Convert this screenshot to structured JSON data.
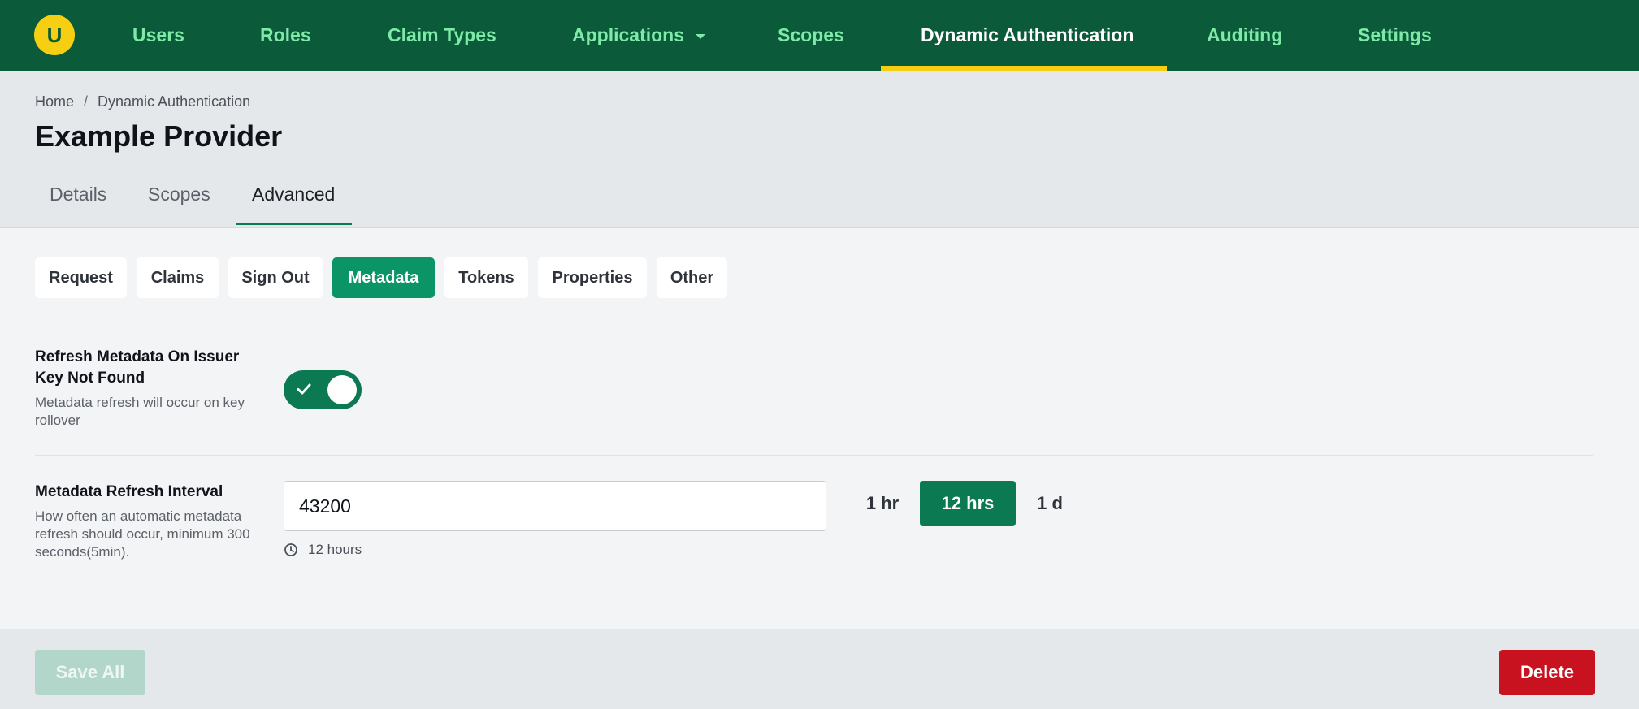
{
  "nav": {
    "logo_letter": "U",
    "items": [
      {
        "label": "Users"
      },
      {
        "label": "Roles"
      },
      {
        "label": "Claim Types"
      },
      {
        "label": "Applications"
      },
      {
        "label": "Scopes"
      },
      {
        "label": "Dynamic Authentication"
      },
      {
        "label": "Auditing"
      },
      {
        "label": "Settings"
      }
    ],
    "active": "Dynamic Authentication"
  },
  "breadcrumb": {
    "home": "Home",
    "separator": "/",
    "current": "Dynamic Authentication"
  },
  "page": {
    "title": "Example Provider"
  },
  "tabs": [
    {
      "label": "Details"
    },
    {
      "label": "Scopes"
    },
    {
      "label": "Advanced"
    }
  ],
  "active_tab": "Advanced",
  "subtabs": [
    {
      "label": "Request"
    },
    {
      "label": "Claims"
    },
    {
      "label": "Sign Out"
    },
    {
      "label": "Metadata"
    },
    {
      "label": "Tokens"
    },
    {
      "label": "Properties"
    },
    {
      "label": "Other"
    }
  ],
  "active_subtab": "Metadata",
  "fields": {
    "refresh_on_key_not_found": {
      "label_line1": "Refresh Metadata On Issuer",
      "label_line2": "Key Not Found",
      "desc_line1": "Metadata refresh will occur on key",
      "desc_line2": "rollover",
      "enabled": true
    },
    "refresh_interval": {
      "label": "Metadata Refresh Interval",
      "desc_line1": "How often an automatic metadata",
      "desc_line2": "refresh should occur, minimum 300",
      "desc_line3": "seconds(5min).",
      "value": "43200",
      "hint": "12 hours",
      "presets": [
        {
          "label": "1 hr"
        },
        {
          "label": "12 hrs"
        },
        {
          "label": "1 d"
        }
      ],
      "active_preset": "12 hrs"
    }
  },
  "footer": {
    "save_label": "Save All",
    "delete_label": "Delete"
  },
  "colors": {
    "nav_bg": "#0b5a3a",
    "nav_text": "#7fe9a8",
    "accent_yellow": "#f6cf12",
    "primary_green": "#0b7a52",
    "subtab_active": "#0b9465",
    "danger": "#c8121f",
    "save_disabled": "#b3d6cb"
  }
}
